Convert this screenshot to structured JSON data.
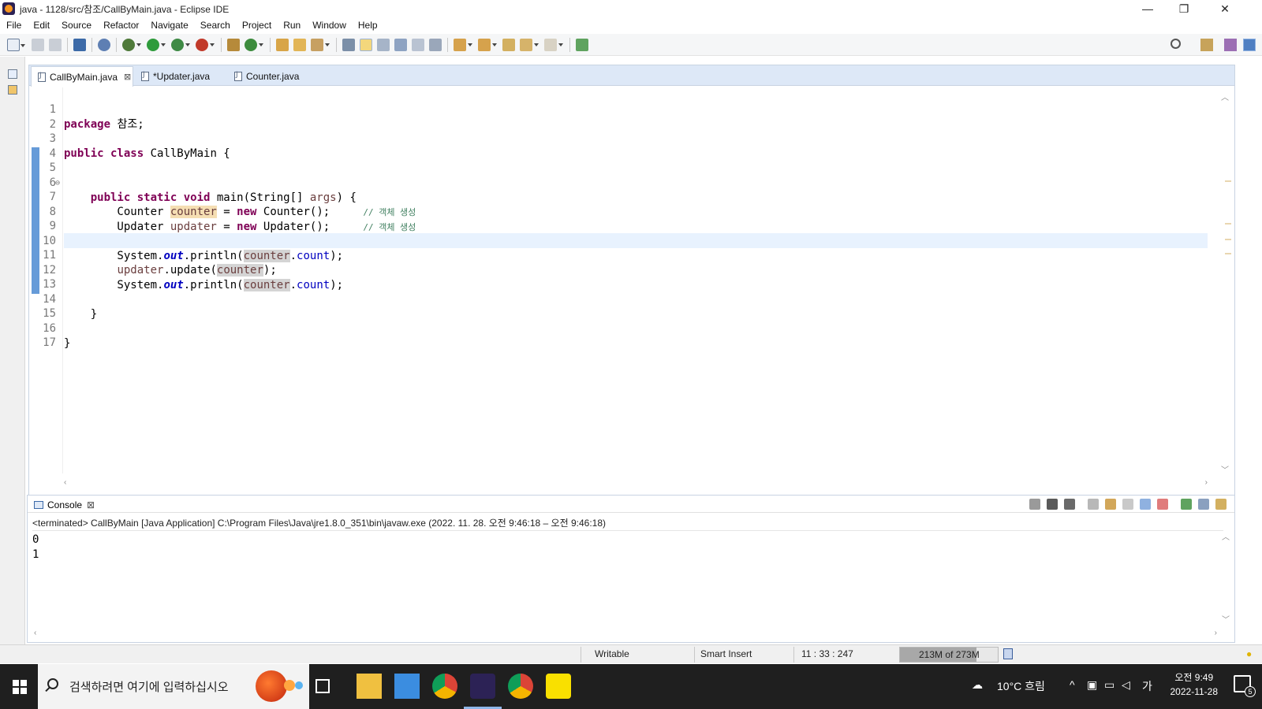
{
  "window": {
    "title": "java - 1128/src/참조/CallByMain.java - Eclipse IDE",
    "minimize": "—",
    "restore": "❐",
    "close": "✕"
  },
  "menu": [
    "File",
    "Edit",
    "Source",
    "Refactor",
    "Navigate",
    "Search",
    "Project",
    "Run",
    "Window",
    "Help"
  ],
  "editor": {
    "tabs": [
      {
        "label": "CallByMain.java",
        "close": "⊠",
        "active": true
      },
      {
        "label": "*Updater.java",
        "active": false
      },
      {
        "label": "Counter.java",
        "active": false
      }
    ],
    "current_line": 11,
    "line_numbers": [
      "1",
      "2",
      "3",
      "4",
      "5",
      "6",
      "7",
      "8",
      "9",
      "10",
      "11",
      "12",
      "13",
      "14",
      "15",
      "16",
      "17"
    ],
    "fold_marker": "⊖",
    "code": {
      "l1_kw": "package",
      "l1_rest": " 참조;",
      "l3_kw": "public class",
      "l3_rest": " CallByMain {",
      "l5_indent": "    ",
      "l5_kw": "public static void",
      "l5_rest1": " main(String[] ",
      "l5_param": "args",
      "l5_rest2": ") {",
      "l7_type": "        Counter ",
      "l7_var": "counter",
      "l7_eq": " = ",
      "l7_kw": "new",
      "l7_rest": " Counter();     ",
      "l7_comment": "// 객체 생성",
      "l8_type": "        Updater ",
      "l8_var": "updater",
      "l8_eq": " = ",
      "l8_kw": "new",
      "l8_rest": " Updater();     ",
      "l8_comment": "// 객체 생성",
      "l10_a": "        System.",
      "l10_out": "out",
      "l10_b": ".println(",
      "l10_var": "counter",
      "l10_c": ".",
      "l10_field": "count",
      "l10_d": ");",
      "l11_indent": "        ",
      "l11_var": "updater",
      "l11_a": ".update(",
      "l11_arg": "counter",
      "l11_b": ");",
      "l12_a": "        System.",
      "l12_out": "out",
      "l12_b": ".println(",
      "l12_var": "counter",
      "l12_c": ".",
      "l12_field": "count",
      "l12_d": ");",
      "l14": "    }",
      "l16": "}"
    }
  },
  "console": {
    "tab_label": "Console",
    "tab_close": "⊠",
    "description": "<terminated> CallByMain [Java Application] C:\\Program Files\\Java\\jre1.8.0_351\\bin\\javaw.exe  (2022. 11. 28. 오전 9:46:18 – 오전 9:46:18)",
    "output": [
      "0",
      "1"
    ]
  },
  "status": {
    "mode": "Writable",
    "insert": "Smart Insert",
    "position": "11 : 33 : 247",
    "heap": "213M of 273M",
    "heap_fraction": 0.78
  },
  "taskbar": {
    "search_placeholder": "검색하려면 여기에 입력하십시오",
    "weather": "10°C  흐림",
    "ime": "가",
    "time": "오전 9:49",
    "date": "2022-11-28",
    "notifications": "5"
  },
  "colors": {
    "keyword": "#7f0055",
    "comment": "#3f7f5f",
    "field": "#0000c0",
    "tab_bar": "#dde8f7",
    "taskbar": "#1f1f1f"
  }
}
